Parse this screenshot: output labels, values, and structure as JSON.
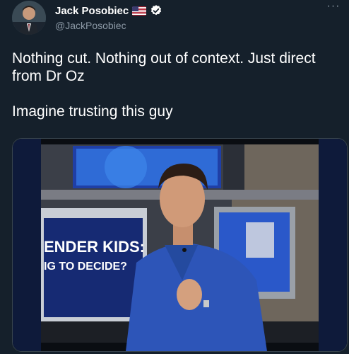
{
  "author": {
    "display_name": "Jack Posobiec",
    "handle": "@JackPosobiec",
    "flag_icon": "us-flag-icon",
    "verified_icon": "verified-badge-icon"
  },
  "tweet": {
    "line1": "Nothing cut. Nothing out of context. Just direct from Dr Oz",
    "line2": "Imagine trusting this guy"
  },
  "media": {
    "type": "video-still",
    "onscreen_caption_line1": "ENDER KIDS:",
    "onscreen_caption_line2": "IG TO DECIDE?"
  },
  "menu": {
    "more_label": "···"
  },
  "colors": {
    "background": "#15202b",
    "secondary_text": "#8b98a5",
    "verified_blue": "#1d9bf0",
    "shirt_blue": "#2d55b8"
  }
}
